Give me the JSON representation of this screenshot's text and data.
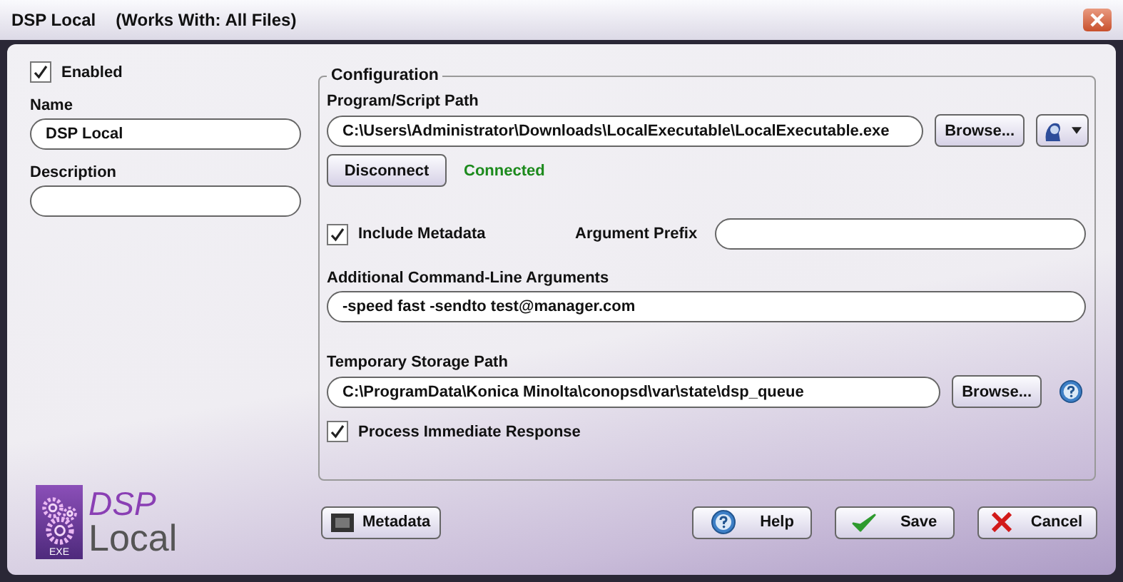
{
  "window": {
    "title": "DSP Local",
    "subtitle": "(Works With: All Files)"
  },
  "enabled": {
    "label": "Enabled",
    "checked": true
  },
  "name": {
    "label": "Name",
    "value": "DSP Local"
  },
  "description": {
    "label": "Description"
  },
  "configuration": {
    "title": "Configuration",
    "program_path": {
      "label": "Program/Script Path",
      "value": "C:\\Users\\Administrator\\Downloads\\LocalExecutable\\LocalExecutable.exe",
      "browse": "Browse..."
    },
    "connection": {
      "button": "Disconnect",
      "status": "Connected"
    },
    "include_metadata": {
      "label": "Include Metadata",
      "checked": true
    },
    "argument_prefix": {
      "label": "Argument Prefix"
    },
    "arguments": {
      "label": "Additional Command-Line Arguments",
      "value": "-speed fast -sendto test@manager.com"
    },
    "storage_path": {
      "label": "Temporary Storage Path",
      "value": "C:\\ProgramData\\Konica Minolta\\conopsd\\var\\state\\dsp_queue",
      "browse": "Browse..."
    },
    "process_immediate": {
      "label": "Process Immediate Response",
      "checked": true
    }
  },
  "logo": {
    "badge": "EXE",
    "line_1": "DSP",
    "line_2": "Local"
  },
  "buttons": [
    {
      "kind": "metadata",
      "label": "Metadata"
    },
    {
      "kind": "help",
      "label": "Help"
    },
    {
      "kind": "save",
      "label": "Save"
    },
    {
      "kind": "cancel",
      "label": "Cancel"
    }
  ]
}
